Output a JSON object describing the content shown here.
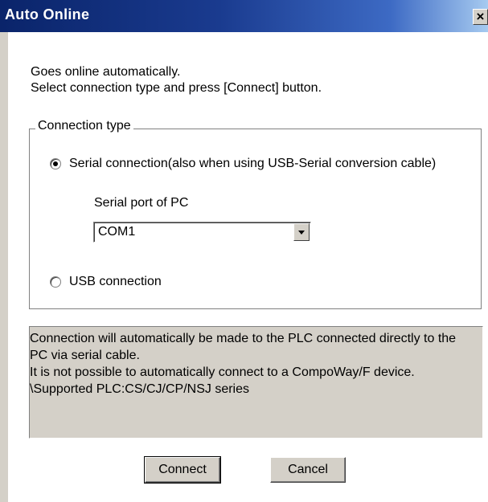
{
  "window": {
    "title": "Auto Online",
    "close_label": "×"
  },
  "intro": {
    "line1": "Goes online automatically.",
    "line2": "Select connection type and press [Connect] button."
  },
  "connection_type": {
    "legend": "Connection type",
    "serial": {
      "label": "Serial connection(also when using USB-Serial conversion cable)",
      "selected": true
    },
    "serial_port_label": "Serial port of PC",
    "serial_port_value": "COM1",
    "usb": {
      "label": "USB connection",
      "selected": false
    }
  },
  "description": {
    "lines": [
      "Connection will automatically be made to the PLC connected directly to the",
      "PC via serial cable.",
      "It is not possible to automatically connect to a CompoWay/F device.",
      "\\Supported PLC:CS/CJ/CP/NSJ series"
    ]
  },
  "buttons": {
    "connect": "Connect",
    "cancel": "Cancel"
  }
}
